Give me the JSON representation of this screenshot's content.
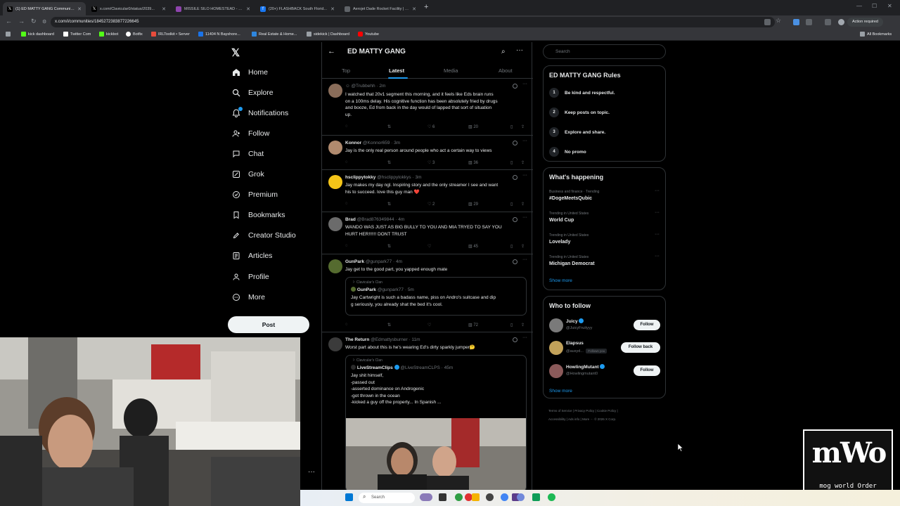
{
  "browser": {
    "tabs": [
      {
        "title": "(1) ED MATTY GANG Communit...",
        "active": true,
        "favicon": "x-icon",
        "color": "#000000"
      },
      {
        "title": "x.com/Clavicular0/status/2039...",
        "active": false,
        "favicon": "x-icon",
        "color": "#000000"
      },
      {
        "title": "MISSILE SILO HOMESTEAD - G...",
        "active": false,
        "favicon": "globe-icon",
        "color": "#8e44ad"
      },
      {
        "title": "(20+) FLASHBACK South Florid...",
        "active": false,
        "favicon": "facebook-icon",
        "color": "#1877f2"
      },
      {
        "title": "Aerojet Dade Rocket Facility | A...",
        "active": false,
        "favicon": "globe-icon",
        "color": "#5f6368"
      }
    ],
    "url": "x.com/i/communities/1845272383877226645",
    "action_required": "Action required",
    "bookmarks": [
      {
        "label": "kick dashboard",
        "color": "#53fc18"
      },
      {
        "label": "Twitter Com",
        "color": "#000000"
      },
      {
        "label": "kickbot",
        "color": "#53fc18"
      },
      {
        "label": "Botfix",
        "color": "#ffffff"
      },
      {
        "label": "IRLToolkit • Server",
        "color": "#e74c3c"
      },
      {
        "label": "11404 N Bayshore...",
        "color": "#1a73e8"
      },
      {
        "label": "Real Estate & Home...",
        "color": "#2e86de"
      },
      {
        "label": "sidekick | Dashboard",
        "color": "#9aa0a6"
      },
      {
        "label": "Youtube",
        "color": "#ff0000"
      }
    ],
    "all_bookmarks": "All Bookmarks"
  },
  "nav": {
    "items": [
      {
        "label": "Home",
        "icon": "home-icon"
      },
      {
        "label": "Explore",
        "icon": "search-icon"
      },
      {
        "label": "Notifications",
        "icon": "bell-icon"
      },
      {
        "label": "Follow",
        "icon": "person-add-icon"
      },
      {
        "label": "Chat",
        "icon": "chat-icon"
      },
      {
        "label": "Grok",
        "icon": "grok-icon"
      },
      {
        "label": "Premium",
        "icon": "premium-icon"
      },
      {
        "label": "Bookmarks",
        "icon": "bookmark-icon"
      },
      {
        "label": "Creator Studio",
        "icon": "rocket-icon"
      },
      {
        "label": "Articles",
        "icon": "article-icon"
      },
      {
        "label": "Profile",
        "icon": "profile-icon"
      },
      {
        "label": "More",
        "icon": "more-circle-icon"
      }
    ],
    "post_label": "Post"
  },
  "community": {
    "title": "ED MATTY GANG",
    "tabs": [
      "Top",
      "Latest",
      "Media",
      "About"
    ],
    "active_tab": "Latest"
  },
  "tweets": [
    {
      "name": "",
      "handle": "@Trubbehh · 2m",
      "text": "I watched that 20v1 segment this morning, and it feels like Eds brain runs\non a 100ms delay. His cognitive function has been absolutely fried by drugs\nand booze, Ed from back in the day would of lapped that sort of situation\nup.",
      "likes": "6",
      "views": "20",
      "avatar_color": "#8a6d5a"
    },
    {
      "name": "Konnor",
      "handle": "@Konnor659 · 3m",
      "text": "Jay is the only real person around people who act a certain way to views",
      "likes": "3",
      "views": "36",
      "avatar_color": "#b08a6e"
    },
    {
      "name": "hsclippytokky",
      "handle": "@hsclippytokkys · 3m",
      "text": "Jay makes my day ngl. Inspiring story and the only streamer I see and want\nhis to succeed. love this guy man ❤️",
      "likes": "2",
      "views": "29",
      "avatar_color": "#f5c518"
    },
    {
      "name": "Brad",
      "handle": "@Brad876349844 · 4m",
      "text": "WANDO WAS JUST AS BIG BULLY TO YOU AND MIA TRYED TO SAY YOU\nHURT HER!!!!!!    DONT TRUST",
      "likes": "",
      "views": "45",
      "avatar_color": "#6b6b6b"
    },
    {
      "name": "GunPark",
      "handle": "@gunpark77 · 4m",
      "text": "Jay get to the good part, you yapped enough mate",
      "likes": "",
      "views": "72",
      "avatar_color": "#556b2f",
      "quote": {
        "community": "Clavicular's Clan",
        "name": "GunPark",
        "handle": "@gunpark77 · 5m",
        "text": "Jay Cartwright is such a badass name, piss on Andro's suitcase and dip\ng seriously, you already shat the bed it's cool."
      }
    },
    {
      "name": "The Return",
      "handle": "@Edmattysburner · 11m",
      "text": "Worst part about this is he's wearing Ed's dirty sparkly jumper🤔",
      "avatar_color": "#3b3b3b",
      "quote": {
        "community": "Clavicular's Clan",
        "name": "LiveStreamClips",
        "handle": "@LiveStreamCLPS · 45m",
        "text": "Jay shit himself,\n-passed out\n-asserted dominance on Androgenic\n-got thrown in the ocean\n-kicked a guy off the property... In Spanish ..."
      }
    }
  ],
  "right": {
    "search_placeholder": "Search",
    "rules_title": "ED MATTY GANG Rules",
    "rules": [
      {
        "num": "1",
        "text": "Be kind and respectful."
      },
      {
        "num": "2",
        "text": "Keep posts on topic."
      },
      {
        "num": "3",
        "text": "Explore and share."
      },
      {
        "num": "4",
        "text": "No promo"
      }
    ],
    "happening_title": "What's happening",
    "trends": [
      {
        "meta": "Business and finance · Trending",
        "name": "#DogeMeetsQubic"
      },
      {
        "meta": "Trending in United States",
        "name": "World Cup"
      },
      {
        "meta": "Trending in United States",
        "name": "Lovelady"
      },
      {
        "meta": "Trending in United States",
        "name": "Michigan Democrat"
      }
    ],
    "show_more": "Show more",
    "wtf_title": "Who to follow",
    "who_to_follow": [
      {
        "name": "Juicy",
        "handle": "@JuicyFruityyy",
        "button": "Follow",
        "verified": true,
        "follows_you": "",
        "avatar_color": "#7a7a7a"
      },
      {
        "name": "Elapsus",
        "handle": "@ausyd...",
        "button": "Follow back",
        "verified": false,
        "follows_you": "Follows you",
        "avatar_color": "#c2a25a"
      },
      {
        "name": "HowlingMutant",
        "handle": "@Howlingmutant0",
        "button": "Follow",
        "verified": true,
        "follows_you": "",
        "avatar_color": "#8b5a5a"
      }
    ],
    "wtf_show_more": "Show more",
    "footer": [
      "Terms of Service",
      "|",
      "Privacy Policy",
      "|",
      "Cookie Policy",
      "|",
      "Accessibility",
      "|",
      "Ads info",
      "|",
      "More ···",
      "© 2026 X Corp."
    ]
  },
  "overlay": {
    "logo_text": "mWo",
    "logo_sub": "mog world Order"
  },
  "taskbar": {
    "search_placeholder": "Search"
  }
}
